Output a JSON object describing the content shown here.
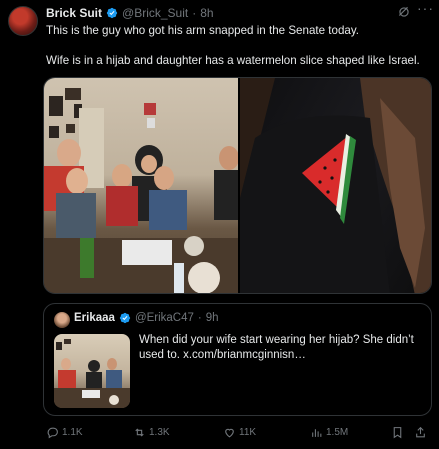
{
  "author": {
    "name": "Brick Suit",
    "handle": "@Brick_Suit",
    "separator": "·",
    "time": "8h"
  },
  "tweet": {
    "line1": "This is the guy who got his arm snapped in the Senate today.",
    "line2": "Wife is in a hijab and daughter has a watermelon slice shaped like Israel."
  },
  "quoted": {
    "name": "Erikaaa",
    "handle": "@ErikaC47",
    "separator": "·",
    "time": "9h",
    "text": "When did your wife start wearing her hijab? She didn’t used to.  x.com/brianmcginnisn…"
  },
  "actions": {
    "replies": "1.1K",
    "reposts": "1.3K",
    "likes": "11K",
    "views": "1.5M"
  },
  "colors": {
    "background": "#000000",
    "text": "#e7e9ea",
    "muted": "#71767b",
    "border": "#2f3336",
    "verified": "#1d9bf0"
  }
}
